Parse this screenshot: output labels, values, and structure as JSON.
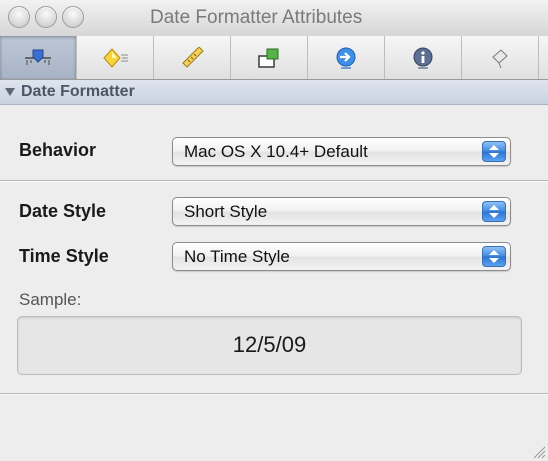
{
  "window": {
    "title": "Date Formatter Attributes"
  },
  "toolbar": {
    "tabs": [
      {
        "icon": "attributes-slider-icon",
        "selected": true
      },
      {
        "icon": "effects-diamond-icon",
        "selected": false
      },
      {
        "icon": "size-ruler-icon",
        "selected": false
      },
      {
        "icon": "bindings-icon",
        "selected": false
      },
      {
        "icon": "connections-arrow-icon",
        "selected": false
      },
      {
        "icon": "identity-info-icon",
        "selected": false
      },
      {
        "icon": "applescript-icon",
        "selected": false
      }
    ]
  },
  "section": {
    "title": "Date Formatter"
  },
  "behavior": {
    "label": "Behavior",
    "value": "Mac OS X 10.4+ Default"
  },
  "date_style": {
    "label": "Date Style",
    "value": "Short Style"
  },
  "time_style": {
    "label": "Time Style",
    "value": "No Time Style"
  },
  "sample": {
    "label": "Sample:",
    "value": "12/5/09"
  },
  "colors": {
    "accent": "#3f87e0",
    "selected_tab": "#b3bfd0",
    "section_header": "#d4dbe8"
  }
}
